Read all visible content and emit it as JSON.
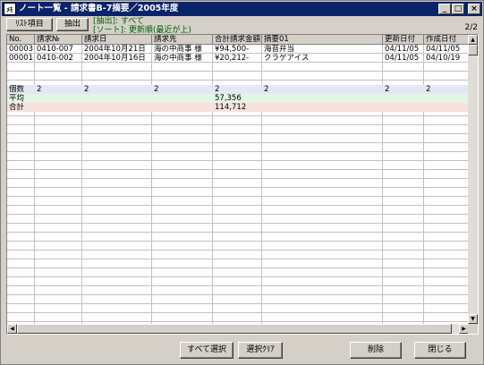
{
  "window": {
    "title": "ノート一覧 - 請求書B-7摘要／2005年度",
    "icon_text": "ﾒﾓ",
    "minimize": "_",
    "maximize": "□",
    "close": "×"
  },
  "toolbar": {
    "list_items_label": "ﾘｽﾄ項目",
    "extract_label": "抽出",
    "filter_status": "[抽出]: すべて",
    "sort_status": "[ソート]: 更新順(最近が上)",
    "page_indicator": "2/2"
  },
  "grid": {
    "columns": [
      "No.",
      "請求№",
      "請求日",
      "請求先",
      "合計請求金額",
      "摘要01",
      "更新日付",
      "作成日付"
    ],
    "rows": [
      [
        "00003",
        "0410-007",
        "2004年10月21日",
        "海の中商事 様",
        "¥94,500-",
        "海苔弁当",
        "04/11/05",
        "04/11/05"
      ],
      [
        "00001",
        "0410-002",
        "2004年10月16日",
        "海の中商事 様",
        "¥20,212-",
        "クラゲアイス",
        "04/11/05",
        "04/10/19"
      ]
    ],
    "summary": {
      "count": {
        "label": "個数",
        "values": [
          "2",
          "2",
          "2",
          "2",
          "2",
          "2",
          "2"
        ]
      },
      "average": {
        "label": "平均",
        "value": "57,356"
      },
      "total": {
        "label": "合計",
        "value": "114,712"
      }
    },
    "band_colors": {
      "count": "#e6e6f5",
      "average": "#e3f5e3",
      "total": "#f7e0e0"
    }
  },
  "footer": {
    "select_all_label": "すべて選択",
    "clear_selection_label": "選択ｸﾘｱ",
    "delete_label": "削除",
    "close_label": "閉じる"
  }
}
